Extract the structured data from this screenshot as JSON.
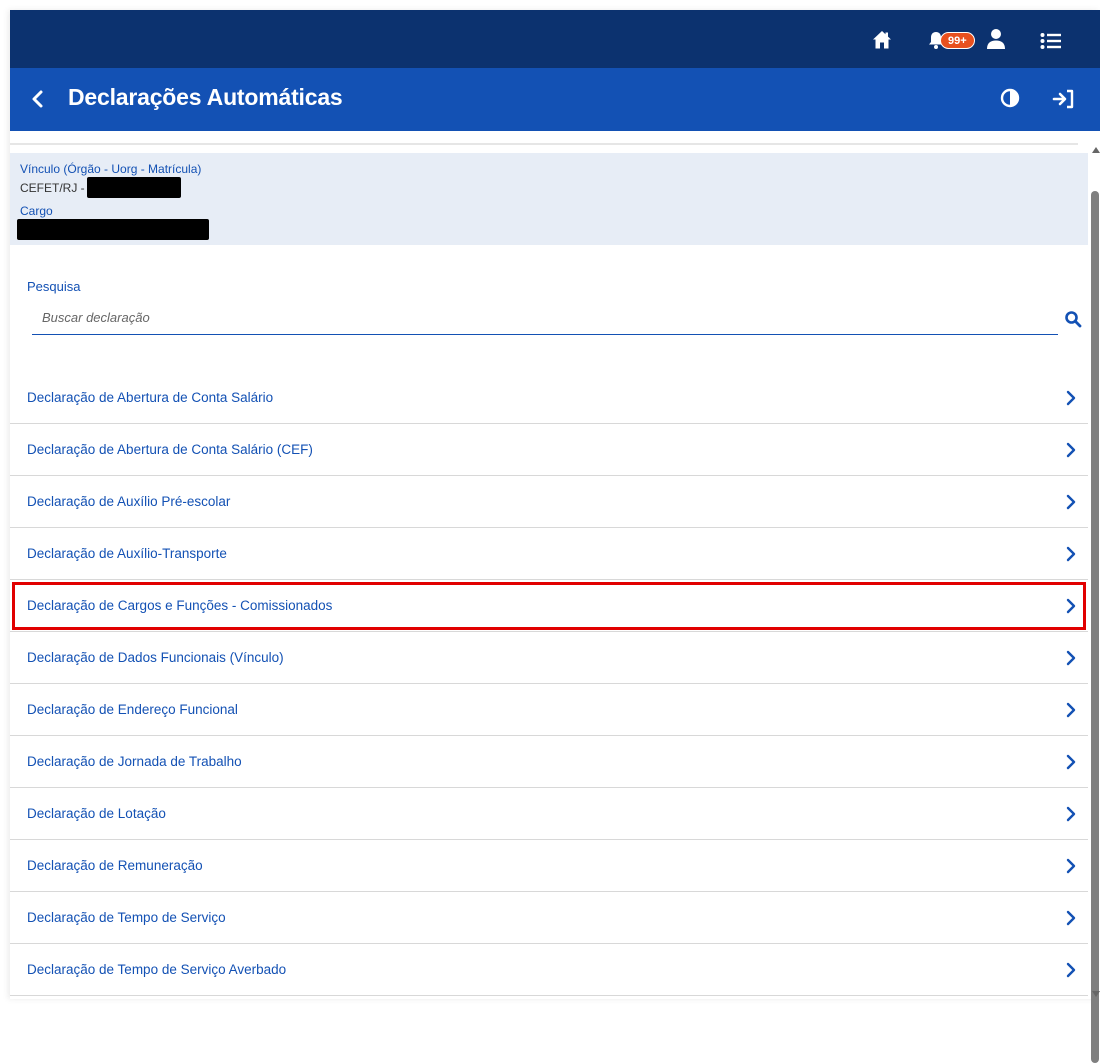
{
  "header": {
    "notifications_badge": "99+",
    "title": "Declarações Automáticas"
  },
  "vinculo": {
    "label": "Vínculo (Órgão - Uorg - Matrícula)",
    "value_prefix": "CEFET/RJ -",
    "cargo_label": "Cargo"
  },
  "search": {
    "label": "Pesquisa",
    "placeholder": "Buscar declaração"
  },
  "declarations": [
    {
      "label": "Declaração de Abertura de Conta Salário"
    },
    {
      "label": "Declaração de Abertura de Conta Salário (CEF)"
    },
    {
      "label": "Declaração de Auxílio Pré-escolar"
    },
    {
      "label": "Declaração de Auxílio-Transporte"
    },
    {
      "label": "Declaração de Cargos e Funções - Comissionados"
    },
    {
      "label": "Declaração de Dados Funcionais (Vínculo)"
    },
    {
      "label": "Declaração de Endereço Funcional"
    },
    {
      "label": "Declaração de Jornada de Trabalho"
    },
    {
      "label": "Declaração de Lotação"
    },
    {
      "label": "Declaração de Remuneração"
    },
    {
      "label": "Declaração de Tempo de Serviço"
    },
    {
      "label": "Declaração de Tempo de Serviço Averbado"
    }
  ],
  "icons": {
    "home": "home-icon",
    "bell": "bell-icon",
    "user": "user-icon",
    "menu": "list-menu-icon",
    "back": "chevron-left-icon",
    "contrast": "contrast-icon",
    "logout": "sign-out-icon",
    "search": "search-icon",
    "chevron": "chevron-right-icon"
  },
  "colors": {
    "topbar": "#0c326f",
    "titlebar": "#1351b4",
    "link": "#1351b4",
    "badge": "#e8501e",
    "highlight": "#e10000",
    "info_panel": "#e7edf6"
  }
}
